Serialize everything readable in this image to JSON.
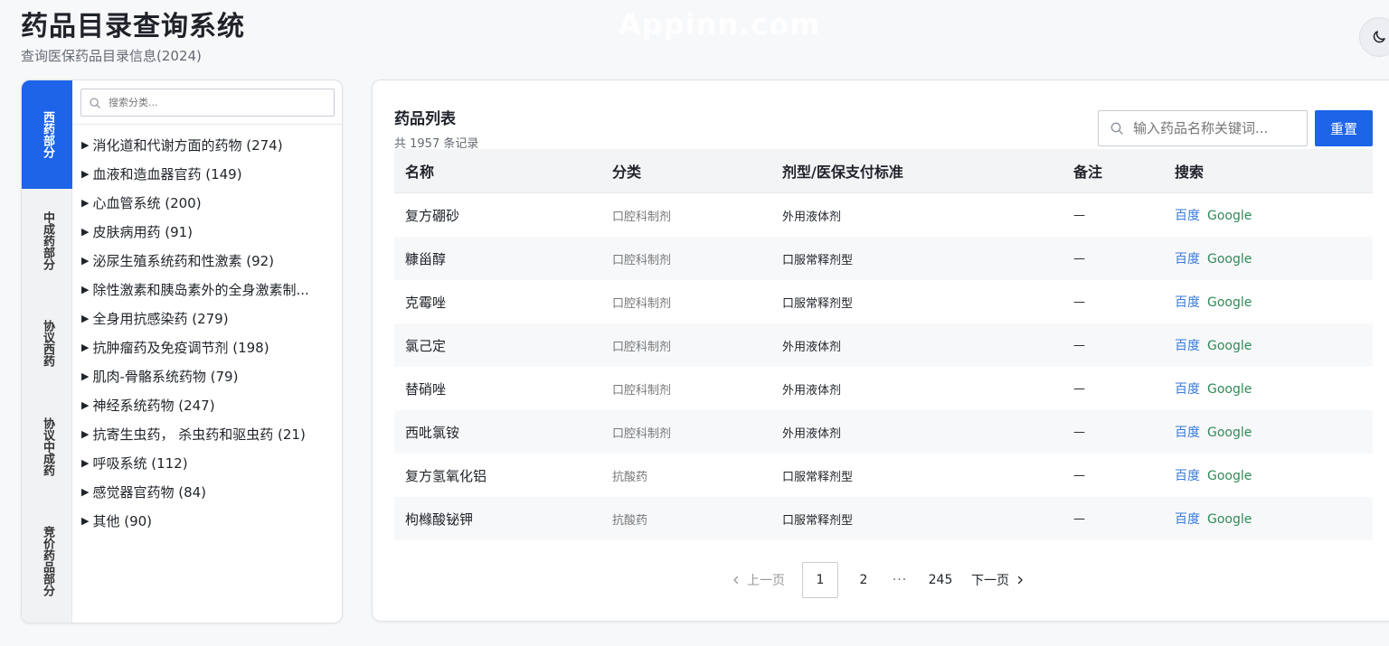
{
  "header": {
    "title": "药品目录查询系统",
    "subtitle": "查询医保药品目录信息(2024)",
    "watermark": "Appinn.com"
  },
  "icons": {
    "theme_toggle": "moon-icon",
    "search": "search-icon"
  },
  "sidebar": {
    "tabs": [
      {
        "label": "西药部分",
        "active": true
      },
      {
        "label": "中成药部分",
        "active": false
      },
      {
        "label": "协议西药",
        "active": false
      },
      {
        "label": "协议中成药",
        "active": false
      },
      {
        "label": "竞价药品部分",
        "active": false
      }
    ],
    "search_placeholder": "搜索分类...",
    "categories": [
      "消化道和代谢方面的药物 (274)",
      "血液和造血器官药 (149)",
      "心血管系统 (200)",
      "皮肤病用药 (91)",
      "泌尿生殖系统药和性激素 (92)",
      "除性激素和胰岛素外的全身激素制...",
      "全身用抗感染药 (279)",
      "抗肿瘤药及免疫调节剂 (198)",
      "肌肉-骨骼系统药物 (79)",
      "神经系统药物 (247)",
      "抗寄生虫药， 杀虫药和驱虫药 (21)",
      "呼吸系统 (112)",
      "感觉器官药物 (84)",
      "其他 (90)"
    ]
  },
  "main": {
    "title": "药品列表",
    "count": "共 1957 条记录",
    "search_placeholder": "输入药品名称关键词...",
    "reset_label": "重置",
    "columns": [
      "名称",
      "分类",
      "剂型/医保支付标准",
      "备注",
      "搜索"
    ],
    "rows": [
      {
        "name": "复方硼砂",
        "category": "口腔科制剂",
        "form": "外用液体剂",
        "note": "—"
      },
      {
        "name": "糠甾醇",
        "category": "口腔科制剂",
        "form": "口服常释剂型",
        "note": "—"
      },
      {
        "name": "克霉唑",
        "category": "口腔科制剂",
        "form": "口服常释剂型",
        "note": "—"
      },
      {
        "name": "氯己定",
        "category": "口腔科制剂",
        "form": "外用液体剂",
        "note": "—"
      },
      {
        "name": "替硝唑",
        "category": "口腔科制剂",
        "form": "外用液体剂",
        "note": "—"
      },
      {
        "name": "西吡氯铵",
        "category": "口腔科制剂",
        "form": "外用液体剂",
        "note": "—"
      },
      {
        "name": "复方氢氧化铝",
        "category": "抗酸药",
        "form": "口服常释剂型",
        "note": "—"
      },
      {
        "name": "枸橼酸铋钾",
        "category": "抗酸药",
        "form": "口服常释剂型",
        "note": "—"
      }
    ],
    "links": {
      "baidu": "百度",
      "google": "Google"
    },
    "pagination": {
      "prev": "上一页",
      "pages": [
        "1",
        "2"
      ],
      "ellipsis": "···",
      "last": "245",
      "next": "下一页",
      "current": "1"
    }
  },
  "colors": {
    "accent": "#1d64e9",
    "baidu_link": "#3b7ad9",
    "google_link": "#2e8b57"
  }
}
